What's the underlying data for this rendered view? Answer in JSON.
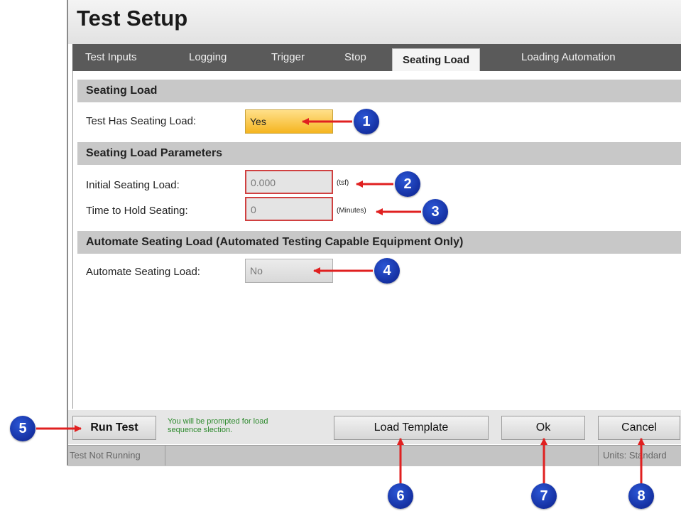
{
  "window": {
    "title": "Test Setup"
  },
  "tabs": [
    {
      "label": "Test Inputs"
    },
    {
      "label": "Logging"
    },
    {
      "label": "Trigger"
    },
    {
      "label": "Stop"
    },
    {
      "label": "Seating Load"
    },
    {
      "label": "Loading Automation"
    }
  ],
  "sections": {
    "seating_load": {
      "title": "Seating Load",
      "has_label": "Test Has Seating Load:",
      "has_value": "Yes"
    },
    "parameters": {
      "title": "Seating Load Parameters",
      "initial_label": "Initial Seating Load:",
      "initial_value": "0.000",
      "initial_unit": "(tsf)",
      "hold_label": "Time to Hold Seating:",
      "hold_value": "0",
      "hold_unit": "(Minutes)"
    },
    "automate": {
      "title": "Automate Seating Load (Automated Testing Capable Equipment Only)",
      "label": "Automate Seating Load:",
      "value": "No"
    }
  },
  "footer": {
    "run_test": "Run Test",
    "hint_line1": "You will be prompted for load",
    "hint_line2": "sequence slection.",
    "load_template": "Load Template",
    "ok": "Ok",
    "cancel": "Cancel"
  },
  "status": {
    "state": "Test Not Running",
    "units": "Units: Standard"
  },
  "callouts": [
    "1",
    "2",
    "3",
    "4",
    "5",
    "6",
    "7",
    "8"
  ],
  "colors": {
    "callout": "#0b1f8a",
    "arrow": "#e02020",
    "yes_field": "#f5b520",
    "invalid_border": "#d04040",
    "hint_text": "#2e8a2e"
  }
}
